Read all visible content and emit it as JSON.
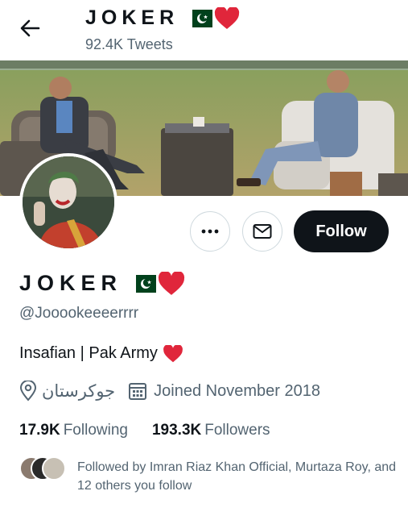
{
  "header": {
    "back_label": "Back",
    "title": "JOKER",
    "tweet_count": "92.4K Tweets"
  },
  "profile": {
    "name": "JOKER",
    "handle": "@Jooookeeeerrrr",
    "bio": "Insafian | Pak Army",
    "location": "جوکرستان",
    "joined": "Joined November 2018",
    "following_count": "17.9K",
    "following_label": "Following",
    "followers_count": "193.3K",
    "followers_label": "Followers",
    "followed_by": "Followed by Imran Riaz Khan Official, Murtaza Roy, and 12 others you follow"
  },
  "actions": {
    "more_label": "More",
    "message_label": "Message",
    "follow_label": "Follow"
  },
  "icons": {
    "back": "arrow-left-icon",
    "more": "ellipsis-icon",
    "message": "envelope-icon",
    "location": "map-pin-icon",
    "calendar": "calendar-icon",
    "flag": "pakistan-flag-emoji",
    "heart": "red-heart-emoji"
  },
  "colors": {
    "text_primary": "#0f1419",
    "text_secondary": "#536471",
    "follow_bg": "#0f1419",
    "heart": "#e0263b",
    "flag_green": "#01411c"
  }
}
